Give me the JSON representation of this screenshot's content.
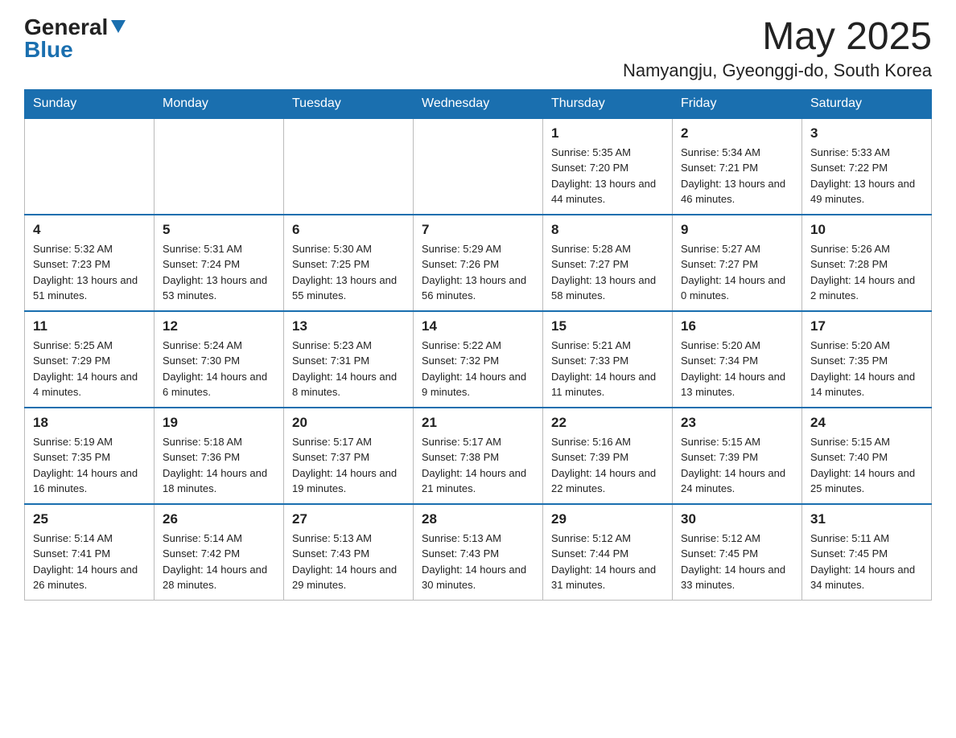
{
  "header": {
    "logo": {
      "general": "General",
      "arrow": "▶",
      "blue": "Blue"
    },
    "title": "May 2025",
    "location": "Namyangju, Gyeonggi-do, South Korea"
  },
  "calendar": {
    "days_of_week": [
      "Sunday",
      "Monday",
      "Tuesday",
      "Wednesday",
      "Thursday",
      "Friday",
      "Saturday"
    ],
    "weeks": [
      [
        {
          "day": "",
          "info": ""
        },
        {
          "day": "",
          "info": ""
        },
        {
          "day": "",
          "info": ""
        },
        {
          "day": "",
          "info": ""
        },
        {
          "day": "1",
          "info": "Sunrise: 5:35 AM\nSunset: 7:20 PM\nDaylight: 13 hours and 44 minutes."
        },
        {
          "day": "2",
          "info": "Sunrise: 5:34 AM\nSunset: 7:21 PM\nDaylight: 13 hours and 46 minutes."
        },
        {
          "day": "3",
          "info": "Sunrise: 5:33 AM\nSunset: 7:22 PM\nDaylight: 13 hours and 49 minutes."
        }
      ],
      [
        {
          "day": "4",
          "info": "Sunrise: 5:32 AM\nSunset: 7:23 PM\nDaylight: 13 hours and 51 minutes."
        },
        {
          "day": "5",
          "info": "Sunrise: 5:31 AM\nSunset: 7:24 PM\nDaylight: 13 hours and 53 minutes."
        },
        {
          "day": "6",
          "info": "Sunrise: 5:30 AM\nSunset: 7:25 PM\nDaylight: 13 hours and 55 minutes."
        },
        {
          "day": "7",
          "info": "Sunrise: 5:29 AM\nSunset: 7:26 PM\nDaylight: 13 hours and 56 minutes."
        },
        {
          "day": "8",
          "info": "Sunrise: 5:28 AM\nSunset: 7:27 PM\nDaylight: 13 hours and 58 minutes."
        },
        {
          "day": "9",
          "info": "Sunrise: 5:27 AM\nSunset: 7:27 PM\nDaylight: 14 hours and 0 minutes."
        },
        {
          "day": "10",
          "info": "Sunrise: 5:26 AM\nSunset: 7:28 PM\nDaylight: 14 hours and 2 minutes."
        }
      ],
      [
        {
          "day": "11",
          "info": "Sunrise: 5:25 AM\nSunset: 7:29 PM\nDaylight: 14 hours and 4 minutes."
        },
        {
          "day": "12",
          "info": "Sunrise: 5:24 AM\nSunset: 7:30 PM\nDaylight: 14 hours and 6 minutes."
        },
        {
          "day": "13",
          "info": "Sunrise: 5:23 AM\nSunset: 7:31 PM\nDaylight: 14 hours and 8 minutes."
        },
        {
          "day": "14",
          "info": "Sunrise: 5:22 AM\nSunset: 7:32 PM\nDaylight: 14 hours and 9 minutes."
        },
        {
          "day": "15",
          "info": "Sunrise: 5:21 AM\nSunset: 7:33 PM\nDaylight: 14 hours and 11 minutes."
        },
        {
          "day": "16",
          "info": "Sunrise: 5:20 AM\nSunset: 7:34 PM\nDaylight: 14 hours and 13 minutes."
        },
        {
          "day": "17",
          "info": "Sunrise: 5:20 AM\nSunset: 7:35 PM\nDaylight: 14 hours and 14 minutes."
        }
      ],
      [
        {
          "day": "18",
          "info": "Sunrise: 5:19 AM\nSunset: 7:35 PM\nDaylight: 14 hours and 16 minutes."
        },
        {
          "day": "19",
          "info": "Sunrise: 5:18 AM\nSunset: 7:36 PM\nDaylight: 14 hours and 18 minutes."
        },
        {
          "day": "20",
          "info": "Sunrise: 5:17 AM\nSunset: 7:37 PM\nDaylight: 14 hours and 19 minutes."
        },
        {
          "day": "21",
          "info": "Sunrise: 5:17 AM\nSunset: 7:38 PM\nDaylight: 14 hours and 21 minutes."
        },
        {
          "day": "22",
          "info": "Sunrise: 5:16 AM\nSunset: 7:39 PM\nDaylight: 14 hours and 22 minutes."
        },
        {
          "day": "23",
          "info": "Sunrise: 5:15 AM\nSunset: 7:39 PM\nDaylight: 14 hours and 24 minutes."
        },
        {
          "day": "24",
          "info": "Sunrise: 5:15 AM\nSunset: 7:40 PM\nDaylight: 14 hours and 25 minutes."
        }
      ],
      [
        {
          "day": "25",
          "info": "Sunrise: 5:14 AM\nSunset: 7:41 PM\nDaylight: 14 hours and 26 minutes."
        },
        {
          "day": "26",
          "info": "Sunrise: 5:14 AM\nSunset: 7:42 PM\nDaylight: 14 hours and 28 minutes."
        },
        {
          "day": "27",
          "info": "Sunrise: 5:13 AM\nSunset: 7:43 PM\nDaylight: 14 hours and 29 minutes."
        },
        {
          "day": "28",
          "info": "Sunrise: 5:13 AM\nSunset: 7:43 PM\nDaylight: 14 hours and 30 minutes."
        },
        {
          "day": "29",
          "info": "Sunrise: 5:12 AM\nSunset: 7:44 PM\nDaylight: 14 hours and 31 minutes."
        },
        {
          "day": "30",
          "info": "Sunrise: 5:12 AM\nSunset: 7:45 PM\nDaylight: 14 hours and 33 minutes."
        },
        {
          "day": "31",
          "info": "Sunrise: 5:11 AM\nSunset: 7:45 PM\nDaylight: 14 hours and 34 minutes."
        }
      ]
    ]
  }
}
